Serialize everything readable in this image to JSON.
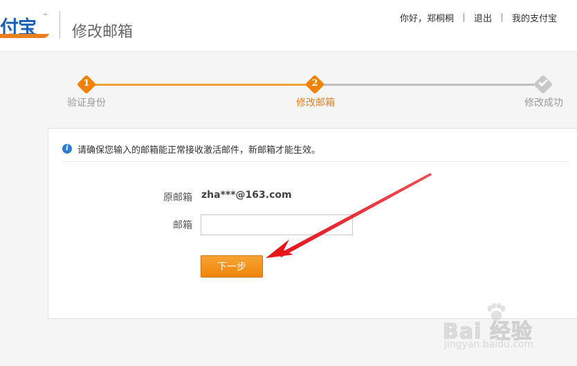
{
  "header": {
    "logo_text": "付宝",
    "logo_tm": "™",
    "page_title": "修改邮箱",
    "links": {
      "greeting": "你好，郑桐桐",
      "logout": "退出",
      "my_alipay": "我的支付宝"
    }
  },
  "steps": {
    "items": [
      {
        "number": "1",
        "label": "验证身份",
        "state": "done"
      },
      {
        "number": "2",
        "label": "修改邮箱",
        "state": "current"
      },
      {
        "number": "",
        "label": "修改成功",
        "state": "pending",
        "icon": "check-icon"
      }
    ],
    "colors": {
      "done": "#f0a23a",
      "current": "#e9811e",
      "pending": "#bdbdbd"
    }
  },
  "notice": {
    "icon": "info-icon",
    "text": "请确保您输入的邮箱能正常接收激活邮件，新邮箱才能生效。"
  },
  "form": {
    "original_label": "原邮箱",
    "original_value": "zha***@163.com",
    "email_label": "邮箱",
    "email_value": "",
    "email_placeholder": "",
    "submit_label": "下一步"
  },
  "annotation": {
    "arrow_color": "#e8141c"
  },
  "watermark": {
    "main": "Bai 经验",
    "sub": "jingyan.baidu.com"
  }
}
